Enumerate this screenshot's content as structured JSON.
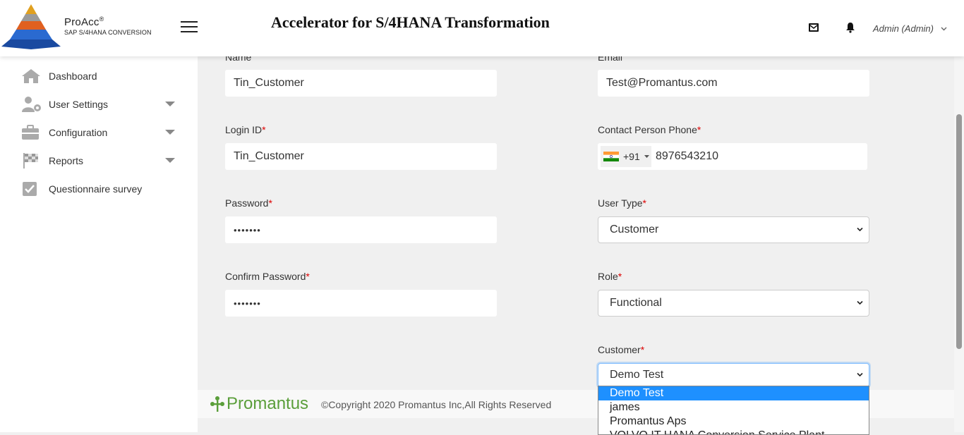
{
  "header": {
    "brand_name": "ProAcc",
    "brand_reg": "®",
    "brand_sub": "SAP S/4HANA CONVERSION",
    "app_title": "Accelerator for S/4HANA Transformation",
    "user": "Admin (Admin)",
    "icons": [
      "menu-icon",
      "mail-icon",
      "bell-icon",
      "chevron-down-icon"
    ]
  },
  "sidebar": {
    "items": [
      {
        "label": "Dashboard",
        "icon": "home-icon"
      },
      {
        "label": "User Settings",
        "icon": "user-gear-icon"
      },
      {
        "label": "Configuration",
        "icon": "briefcase-icon"
      },
      {
        "label": "Reports",
        "icon": "checkered-flag-icon"
      },
      {
        "label": "Questionnaire survey",
        "icon": "checkbox-icon"
      }
    ]
  },
  "form": {
    "name": {
      "label": "Name",
      "value": "Tin_Customer"
    },
    "email": {
      "label": "Email",
      "value": "Test@Promantus.com"
    },
    "login_id": {
      "label": "Login ID",
      "value": "Tin_Customer"
    },
    "phone": {
      "label": "Contact Person Phone",
      "code": "+91",
      "value": "8976543210"
    },
    "password": {
      "label": "Password",
      "value": "•••••••"
    },
    "user_type": {
      "label": "User Type",
      "value": "Customer"
    },
    "confirm_password": {
      "label": "Confirm Password",
      "value": "•••••••"
    },
    "role": {
      "label": "Role",
      "value": "Functional"
    },
    "customer": {
      "label": "Customer",
      "value": "Demo Test",
      "options": [
        "Demo Test",
        "james",
        "Promantus Aps",
        "VOLVO IT HANA Conversion Service Plant"
      ]
    },
    "required_mark": "*"
  },
  "footer": {
    "logo_text": "Promantus",
    "copyright": "©Copyright 2020 Promantus Inc,All Rights Reserved"
  },
  "colors": {
    "accent": "#1e90ff",
    "footer_green": "#5a9e3a",
    "required": "#dd0000"
  }
}
